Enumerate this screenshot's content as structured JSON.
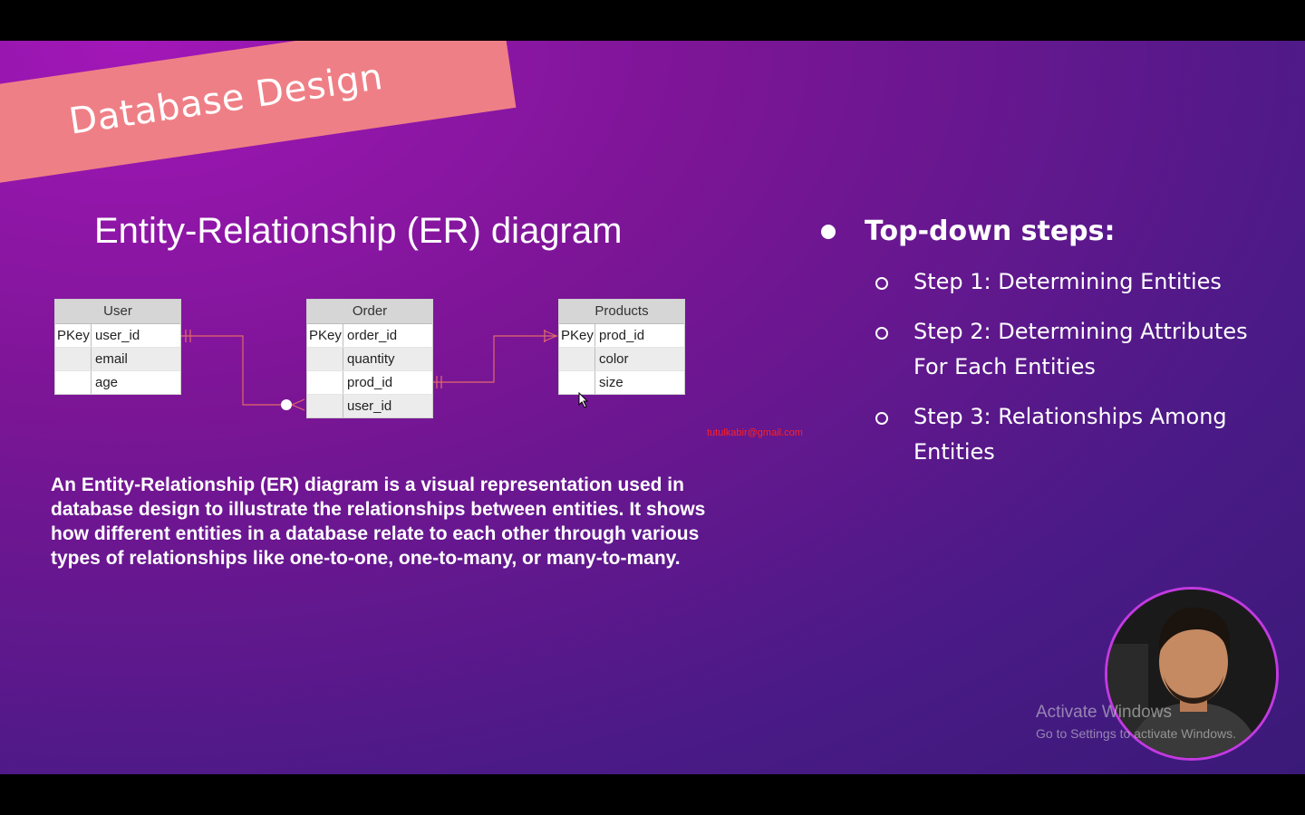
{
  "slide": {
    "ribbon_title": "Database Design",
    "er_title": "Entity-Relationship (ER) diagram",
    "tables": [
      {
        "name": "User",
        "rows": [
          {
            "key": "PKey",
            "field": "user_id"
          },
          {
            "key": "",
            "field": "email"
          },
          {
            "key": "",
            "field": "age"
          }
        ]
      },
      {
        "name": "Order",
        "rows": [
          {
            "key": "PKey",
            "field": "order_id"
          },
          {
            "key": "",
            "field": "quantity"
          },
          {
            "key": "",
            "field": "prod_id"
          },
          {
            "key": "",
            "field": "user_id"
          }
        ]
      },
      {
        "name": "Products",
        "rows": [
          {
            "key": "PKey",
            "field": "prod_id"
          },
          {
            "key": "",
            "field": "color"
          },
          {
            "key": "",
            "field": "size"
          }
        ]
      }
    ],
    "email_mark": "tutulkabir@gmail.com",
    "description": "An Entity-Relationship (ER) diagram is a visual representation used in database design to illustrate the relationships between entities. It shows how different entities in a database relate to each other through various types of relationships like one-to-one, one-to-many, or many-to-many.",
    "steps_title": "Top-down steps:",
    "steps": [
      "Step 1: Determining Entities",
      "Step 2: Determining Attributes For Each Entities",
      "Step 3: Relationships Among Entities"
    ]
  },
  "watermark": {
    "line1": "Activate Windows",
    "line2": "Go to Settings to activate Windows."
  },
  "colors": {
    "ribbon": "#ef7f86",
    "connector": "#e26a6a",
    "webcam_ring": "#c23ae0"
  }
}
